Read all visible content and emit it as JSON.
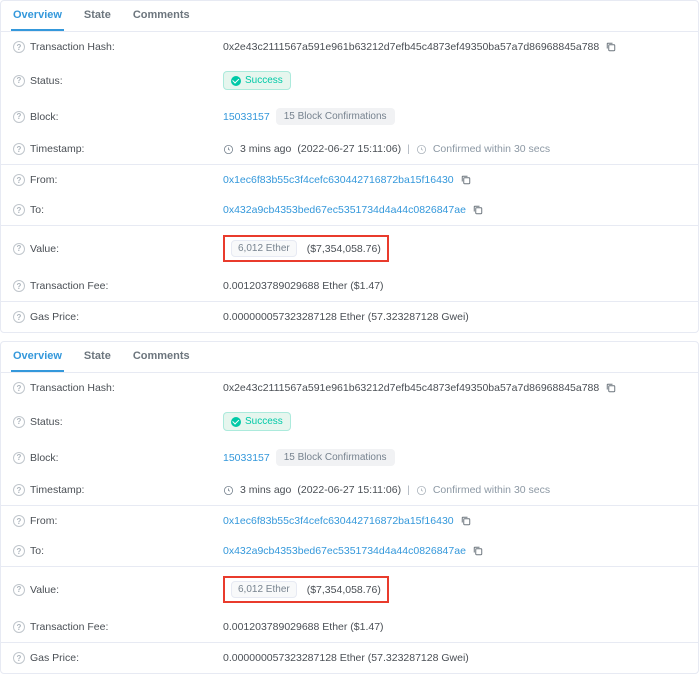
{
  "tabs": {
    "overview": "Overview",
    "state": "State",
    "comments": "Comments"
  },
  "labels": {
    "txhash": "Transaction Hash:",
    "status": "Status:",
    "block": "Block:",
    "timestamp": "Timestamp:",
    "from": "From:",
    "to": "To:",
    "value": "Value:",
    "txfee": "Transaction Fee:",
    "gasprice": "Gas Price:"
  },
  "tx": {
    "hash": "0x2e43c2111567a591e961b63212d7efb45c4873ef49350ba57a7d86968845a788",
    "status": "Success",
    "block": "15033157",
    "confirmations": "15 Block Confirmations",
    "time_ago": "3 mins ago",
    "time_exact": "(2022-06-27 15:11:06)",
    "confirmed_within": "Confirmed within 30 secs",
    "from": "0x1ec6f83b55c3f4cefc630442716872ba15f16430",
    "to": "0x432a9cb4353bed67ec5351734d4a44c0826847ae",
    "value_ether": "6,012 Ether",
    "value_usd": "($7,354,058.76)",
    "txfee": "0.001203789029688 Ether ($1.47)",
    "gasprice": "0.000000057323287128 Ether (57.323287128 Gwei)"
  }
}
